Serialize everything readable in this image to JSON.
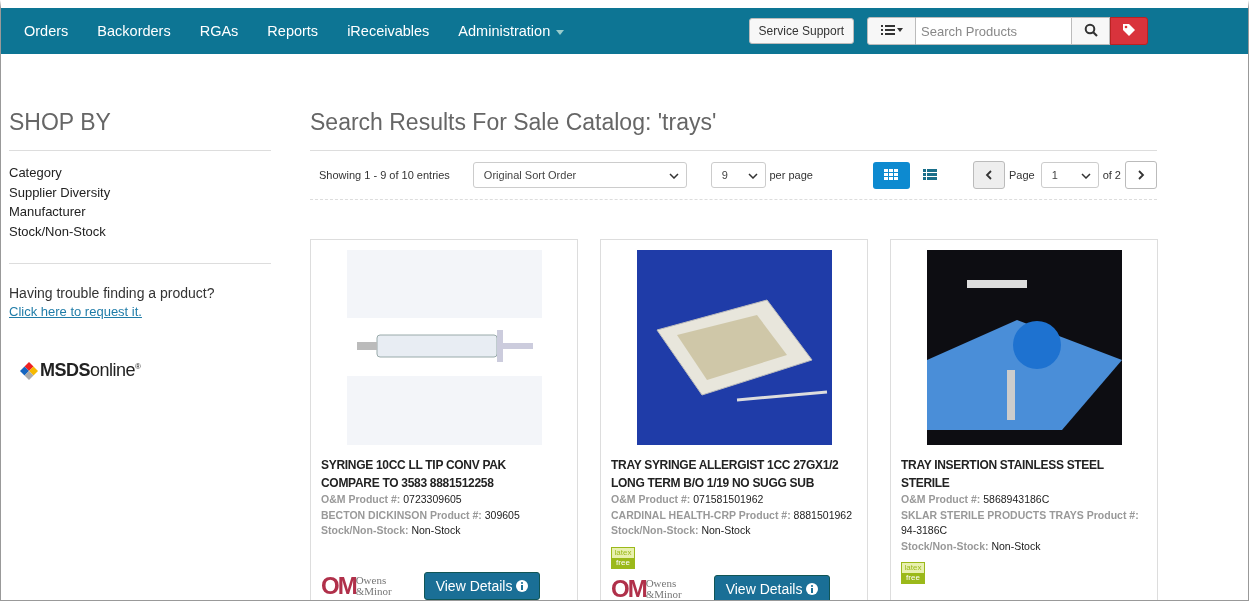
{
  "nav": {
    "items": [
      {
        "label": "Orders",
        "dropdown": false
      },
      {
        "label": "Backorders",
        "dropdown": false
      },
      {
        "label": "RGAs",
        "dropdown": false
      },
      {
        "label": "Reports",
        "dropdown": false
      },
      {
        "label": "iReceivables",
        "dropdown": false
      },
      {
        "label": "Administration",
        "dropdown": true
      }
    ],
    "service_button": "Service Support",
    "search": {
      "placeholder": "Search Products"
    }
  },
  "sidebar": {
    "title": "SHOP BY",
    "filters": [
      "Category",
      "Supplier Diversity",
      "Manufacturer",
      "Stock/Non-Stock"
    ],
    "help_text": "Having trouble finding a product?",
    "help_link": "Click here to request it.",
    "msds_logo": {
      "bold": "MSDS",
      "light": "online",
      "mark": "®"
    }
  },
  "heading": "Search Results For Sale Catalog: 'trays'",
  "toolbar": {
    "showing": "Showing 1 - 9 of 10 entries",
    "sort": "Original Sort Order",
    "per_page_value": "9",
    "per_page_label": "per page",
    "views": [
      {
        "kind": "grid",
        "selected": true
      },
      {
        "kind": "list",
        "selected": false
      }
    ],
    "page_label": "Page",
    "page_value": "1",
    "page_of": "of 2"
  },
  "products": [
    {
      "title": "SYRINGE 10CC LL TIP CONV PAK COMPARE TO 3583 8881512258",
      "fields": [
        {
          "label": "O&M Product #:",
          "value": "0723309605"
        },
        {
          "label": "BECTON DICKINSON Product #:",
          "value": "309605"
        },
        {
          "label": "Stock/Non-Stock:",
          "value": "Non-Stock"
        }
      ],
      "logo": {
        "mark": "OM",
        "name": "Owens &Minor"
      },
      "button": "View Details"
    },
    {
      "title": "TRAY SYRINGE ALLERGIST 1CC 27GX1/2 LONG TERM B/O 1/19 NO SUGG SUB",
      "fields": [
        {
          "label": "O&M Product #:",
          "value": "071581501962"
        },
        {
          "label": "CARDINAL HEALTH-CRP Product #:",
          "value": "8881501962"
        },
        {
          "label": "Stock/Non-Stock:",
          "value": "Non-Stock"
        }
      ],
      "latex_badge": {
        "top": "latex",
        "bottom": "free"
      },
      "logo": {
        "mark": "OM",
        "name": "Owens &Minor"
      },
      "button": "View Details"
    },
    {
      "title": "TRAY INSERTION STAINLESS STEEL STERILE",
      "fields": [
        {
          "label": "O&M Product #:",
          "value": "5868943186C"
        },
        {
          "label": "SKLAR STERILE PRODUCTS TRAYS Product #:",
          "value": "94-3186C"
        },
        {
          "label": "Stock/Non-Stock:",
          "value": "Non-Stock"
        }
      ],
      "latex_badge": {
        "top": "latex",
        "bottom": "free"
      }
    }
  ]
}
